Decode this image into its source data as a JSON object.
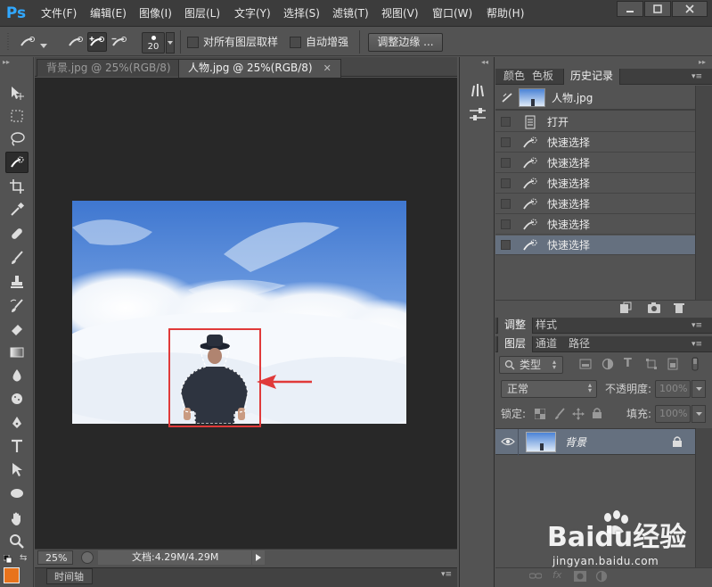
{
  "app": {
    "logo": "Ps"
  },
  "menu": [
    {
      "label": "文件(F)"
    },
    {
      "label": "编辑(E)"
    },
    {
      "label": "图像(I)"
    },
    {
      "label": "图层(L)"
    },
    {
      "label": "文字(Y)"
    },
    {
      "label": "选择(S)"
    },
    {
      "label": "滤镜(T)"
    },
    {
      "label": "视图(V)"
    },
    {
      "label": "窗口(W)"
    },
    {
      "label": "帮助(H)"
    }
  ],
  "options_bar": {
    "brush_size": "20",
    "sample_all_layers": "对所有图层取样",
    "auto_enhance": "自动增强",
    "refine_edge": "调整边缘 ..."
  },
  "tabs": [
    {
      "label": "背景.jpg @ 25%(RGB/8)",
      "active": false
    },
    {
      "label": "人物.jpg @ 25%(RGB/8)",
      "active": true
    }
  ],
  "status": {
    "zoom": "25%",
    "doc_size": "文档:4.29M/4.29M"
  },
  "timeline": {
    "label": "时间轴"
  },
  "history_panel": {
    "tabs": [
      "颜色",
      "色板",
      "历史记录"
    ],
    "snapshot": "人物.jpg",
    "items": [
      {
        "label": "打开",
        "icon": "document-icon",
        "selected": false
      },
      {
        "label": "快速选择",
        "icon": "quick-select-icon",
        "selected": false
      },
      {
        "label": "快速选择",
        "icon": "quick-select-icon",
        "selected": false
      },
      {
        "label": "快速选择",
        "icon": "quick-select-icon",
        "selected": false
      },
      {
        "label": "快速选择",
        "icon": "quick-select-icon",
        "selected": false
      },
      {
        "label": "快速选择",
        "icon": "quick-select-icon",
        "selected": false
      },
      {
        "label": "快速选择",
        "icon": "quick-select-icon",
        "selected": true
      }
    ]
  },
  "adjust_panel": {
    "tabs": [
      "调整",
      "样式"
    ]
  },
  "layers_panel": {
    "tabs": [
      "图层",
      "通道",
      "路径"
    ],
    "filter": "类型",
    "blend_mode": "正常",
    "opacity_label": "不透明度:",
    "opacity": "100%",
    "lock_label": "锁定:",
    "fill_label": "填充:",
    "fill": "100%",
    "layer_name": "背景"
  },
  "watermark": {
    "brand": "Baidu经验",
    "url": "jingyan.baidu.com"
  },
  "colors": {
    "selection_box": "#e03a3a",
    "arrow": "#e03a3a",
    "foreground": "#e8731c",
    "selected_row": "#65707f"
  }
}
